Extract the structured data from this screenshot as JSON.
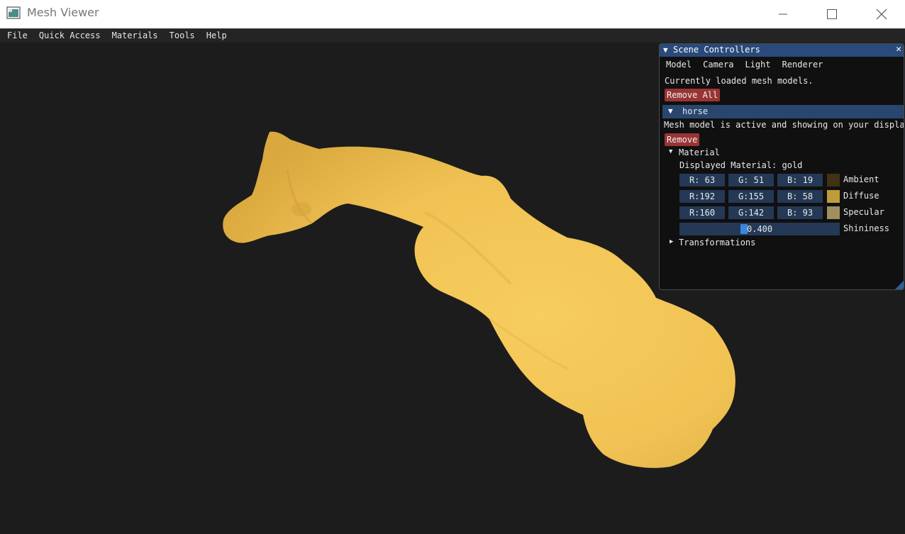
{
  "window": {
    "title": "Mesh Viewer"
  },
  "menubar": {
    "items": [
      "File",
      "Quick Access",
      "Materials",
      "Tools",
      "Help"
    ]
  },
  "viewport": {
    "background_color": "#1c1c1c",
    "mesh_color": "#f2c558"
  },
  "panel": {
    "title": "Scene Controllers",
    "tabs": [
      "Model",
      "Camera",
      "Light",
      "Renderer"
    ],
    "loaded_text": "Currently loaded mesh models.",
    "remove_all_label": "Remove All",
    "model": {
      "name": "horse",
      "status_text": "Mesh model is active and showing on your display",
      "remove_label": "Remove",
      "material": {
        "header": "Material",
        "displayed_text": "Displayed Material: gold",
        "rows": [
          {
            "fields": [
              "R: 63",
              "G: 51",
              "B: 19"
            ],
            "swatch": "#3f3313",
            "label": "Ambient"
          },
          {
            "fields": [
              "R:192",
              "G:155",
              "B: 58"
            ],
            "swatch": "#c09b3a",
            "label": "Diffuse"
          },
          {
            "fields": [
              "R:160",
              "G:142",
              "B: 93"
            ],
            "swatch": "#a08e5d",
            "label": "Specular"
          }
        ],
        "shininess": {
          "value": "0.400",
          "label": "Shininess"
        }
      },
      "transformations_header": "Transformations"
    }
  }
}
